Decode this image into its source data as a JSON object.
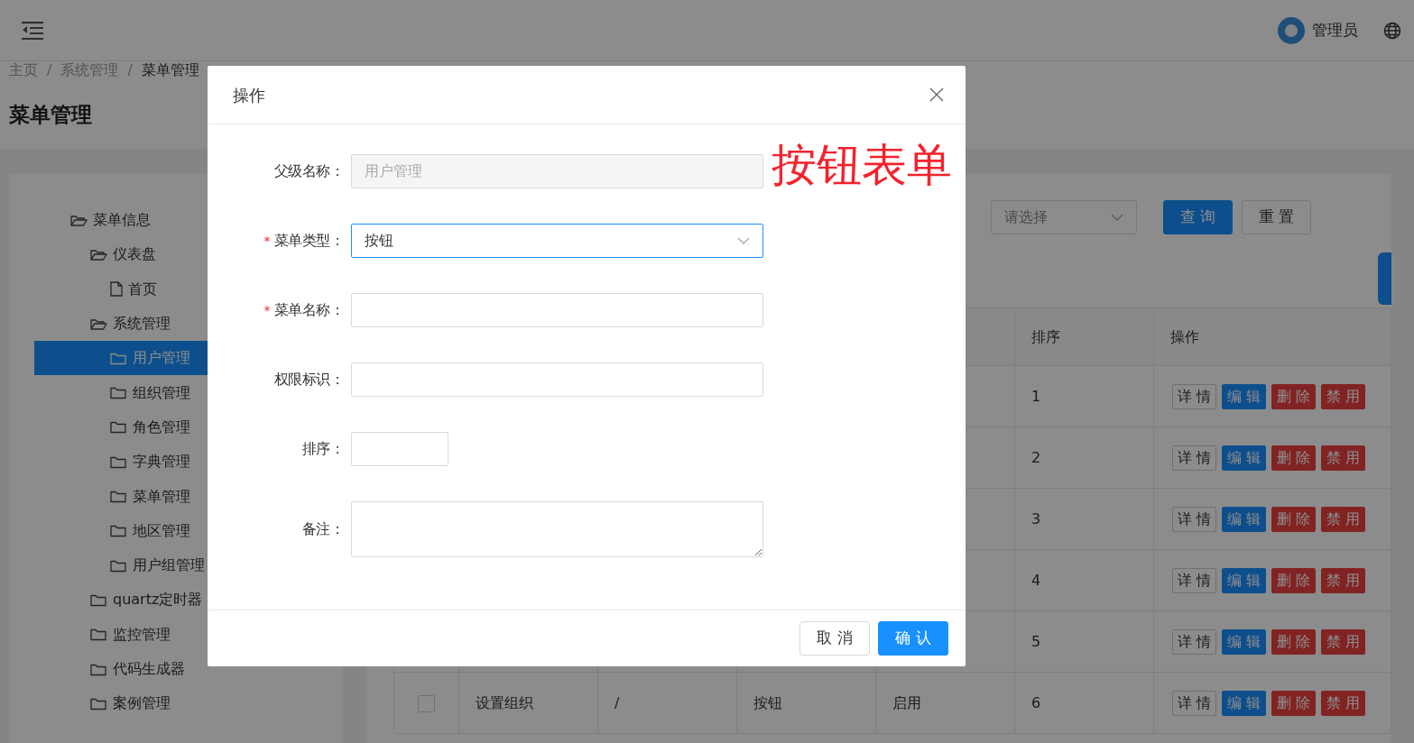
{
  "header": {
    "user": "管理员"
  },
  "breadcrumb": [
    {
      "kind": "link",
      "label": "主页"
    },
    {
      "kind": "separator",
      "label": "/"
    },
    {
      "kind": "link",
      "label": "系统管理"
    },
    {
      "kind": "separator",
      "label": "/"
    },
    {
      "kind": "current",
      "label": "菜单管理"
    }
  ],
  "page_title": "菜单管理",
  "tree": [
    {
      "label": "菜单信息",
      "kind": "folder",
      "expanded": true,
      "selected": false,
      "children": [
        {
          "label": "仪表盘",
          "kind": "folder",
          "expanded": true,
          "selected": false,
          "children": [
            {
              "label": "首页",
              "kind": "file",
              "selected": false
            }
          ]
        },
        {
          "label": "系统管理",
          "kind": "folder",
          "expanded": true,
          "selected": false,
          "children": [
            {
              "label": "用户管理",
              "kind": "folder",
              "expanded": false,
              "selected": true
            },
            {
              "label": "组织管理",
              "kind": "folder",
              "expanded": false,
              "selected": false
            },
            {
              "label": "角色管理",
              "kind": "folder",
              "expanded": false,
              "selected": false
            },
            {
              "label": "字典管理",
              "kind": "folder",
              "expanded": false,
              "selected": false
            },
            {
              "label": "菜单管理",
              "kind": "folder",
              "expanded": false,
              "selected": false
            },
            {
              "label": "地区管理",
              "kind": "folder",
              "expanded": false,
              "selected": false
            },
            {
              "label": "用户组管理",
              "kind": "folder",
              "expanded": false,
              "selected": false
            }
          ]
        },
        {
          "label": "quartz定时器",
          "kind": "folder",
          "expanded": false,
          "selected": false
        },
        {
          "label": "监控管理",
          "kind": "folder",
          "expanded": false,
          "selected": false
        },
        {
          "label": "代码生成器",
          "kind": "folder",
          "expanded": false,
          "selected": false
        },
        {
          "label": "案例管理",
          "kind": "folder",
          "expanded": false,
          "selected": false
        }
      ]
    }
  ],
  "filter": {
    "placeholder": "请选择",
    "buttons": [
      {
        "label": "查 询",
        "kind": "primary"
      },
      {
        "label": "重 置",
        "kind": "default"
      }
    ]
  },
  "table": {
    "columns": [
      {
        "label": "排序"
      },
      {
        "label": "操作"
      }
    ],
    "rows": [
      {
        "sort": "1",
        "actions": [
          {
            "label": "详 情",
            "kind": "default"
          },
          {
            "label": "编 辑",
            "kind": "primary"
          },
          {
            "label": "删 除",
            "kind": "danger"
          },
          {
            "label": "禁 用",
            "kind": "danger"
          }
        ]
      },
      {
        "sort": "2",
        "actions": [
          {
            "label": "详 情",
            "kind": "default"
          },
          {
            "label": "编 辑",
            "kind": "primary"
          },
          {
            "label": "删 除",
            "kind": "danger"
          },
          {
            "label": "禁 用",
            "kind": "danger"
          }
        ]
      },
      {
        "sort": "3",
        "actions": [
          {
            "label": "详 情",
            "kind": "default"
          },
          {
            "label": "编 辑",
            "kind": "primary"
          },
          {
            "label": "删 除",
            "kind": "danger"
          },
          {
            "label": "禁 用",
            "kind": "danger"
          }
        ]
      },
      {
        "sort": "4",
        "actions": [
          {
            "label": "详 情",
            "kind": "default"
          },
          {
            "label": "编 辑",
            "kind": "primary"
          },
          {
            "label": "删 除",
            "kind": "danger"
          },
          {
            "label": "禁 用",
            "kind": "danger"
          }
        ]
      },
      {
        "sort": "5",
        "actions": [
          {
            "label": "详 情",
            "kind": "default"
          },
          {
            "label": "编 辑",
            "kind": "primary"
          },
          {
            "label": "删 除",
            "kind": "danger"
          },
          {
            "label": "禁 用",
            "kind": "danger"
          }
        ]
      },
      {
        "checked": false,
        "cells": [
          "设置组织",
          "/",
          "按钮",
          "启用"
        ],
        "sort": "6",
        "actions": [
          {
            "label": "详 情",
            "kind": "default"
          },
          {
            "label": "编 辑",
            "kind": "primary"
          },
          {
            "label": "删 除",
            "kind": "danger"
          },
          {
            "label": "禁 用",
            "kind": "danger"
          }
        ]
      }
    ]
  },
  "dialog": {
    "title": "操作",
    "annotation": "按钮表单",
    "fields": [
      {
        "label": "父级名称：",
        "kind": "text",
        "value": "用户管理",
        "disabled": true
      },
      {
        "label": "菜单类型：",
        "kind": "select",
        "required_mark": "*",
        "value": "按钮",
        "focused": true
      },
      {
        "label": "菜单名称：",
        "kind": "text",
        "required_mark": "*"
      },
      {
        "label": "权限标识：",
        "kind": "text"
      },
      {
        "label": "排序：",
        "kind": "number"
      },
      {
        "label": "备注：",
        "kind": "textarea"
      }
    ],
    "buttons": [
      {
        "label": "取 消",
        "kind": "default"
      },
      {
        "label": "确 认",
        "kind": "primary"
      }
    ]
  }
}
